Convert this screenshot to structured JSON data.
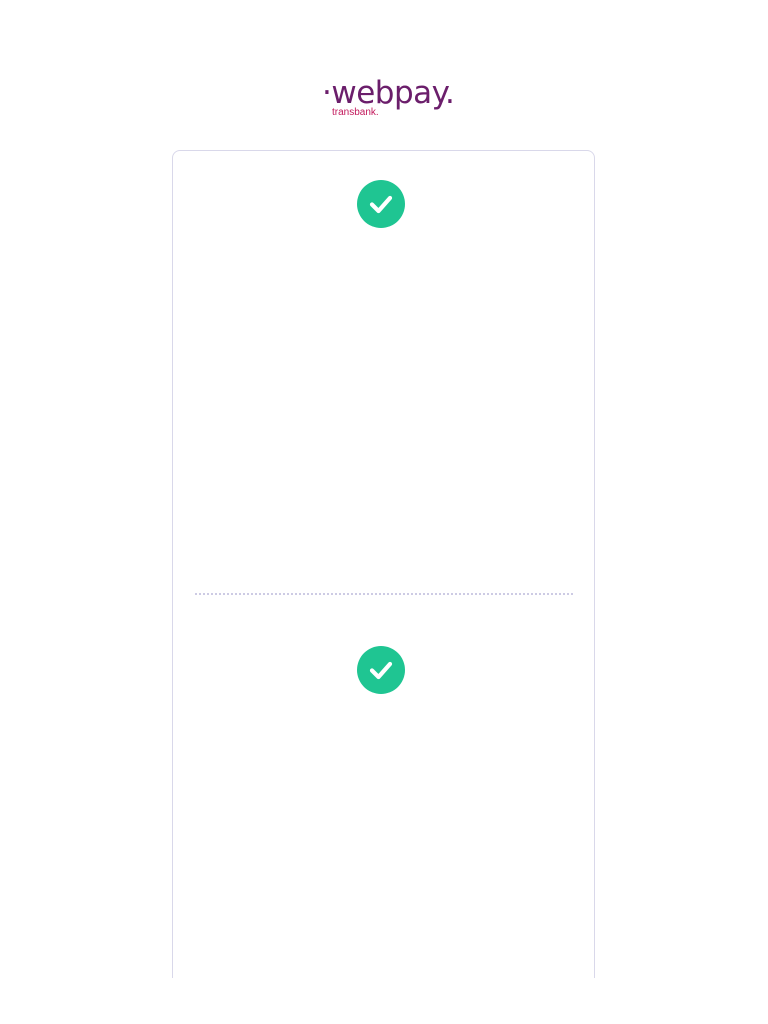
{
  "header": {
    "logo_text": "·webpay.",
    "logo_subtext": "transbank."
  },
  "colors": {
    "brand_purple": "#6b1e6b",
    "brand_magenta": "#c2185b",
    "success_green": "#1fc592",
    "card_border": "#d9d8ea"
  },
  "icons": {
    "success_1": "check-circle-icon",
    "success_2": "check-circle-icon"
  }
}
